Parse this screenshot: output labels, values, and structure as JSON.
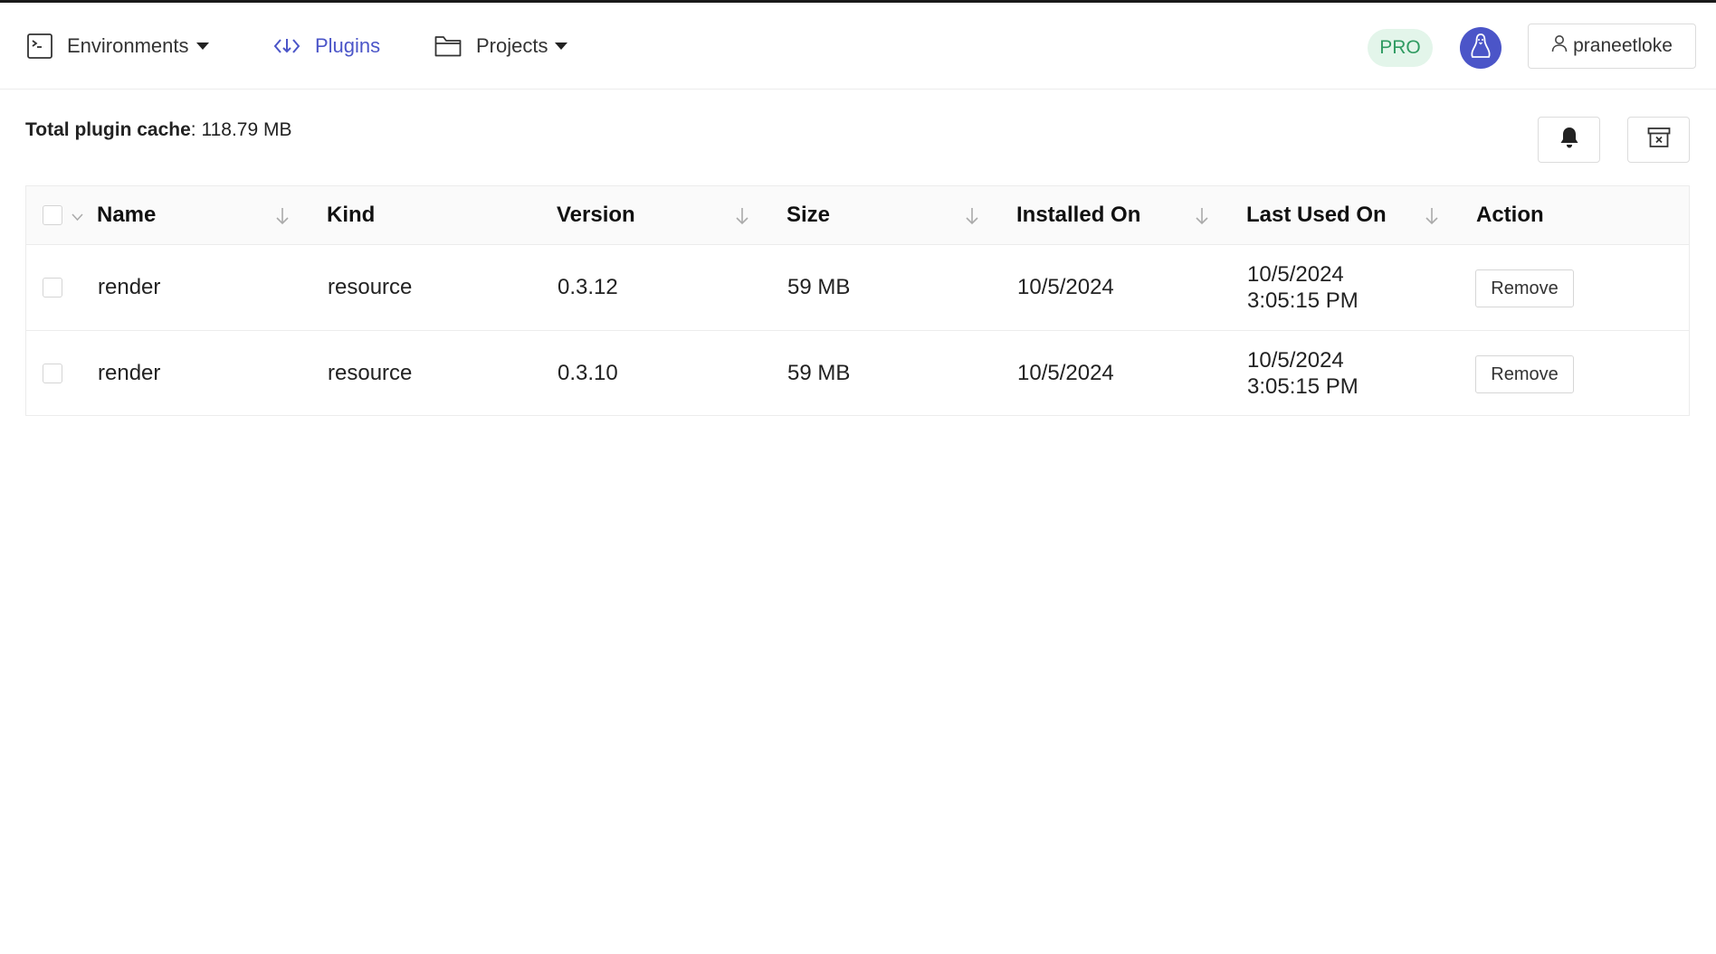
{
  "nav": {
    "environments_label": "Environments",
    "plugins_label": "Plugins",
    "projects_label": "Projects",
    "active": "plugins"
  },
  "account": {
    "plan_badge": "PRO",
    "username": "praneetloke"
  },
  "summary": {
    "label": "Total plugin cache",
    "separator": ": ",
    "value": "118.79 MB"
  },
  "table": {
    "columns": [
      "Name",
      "Kind",
      "Version",
      "Size",
      "Installed On",
      "Last Used On",
      "Action"
    ],
    "rows": [
      {
        "name": "render",
        "kind": "resource",
        "version": "0.3.12",
        "size": "59 MB",
        "installed_on": "10/5/2024",
        "last_used_date": "10/5/2024",
        "last_used_time": "3:05:15 PM",
        "action": "Remove"
      },
      {
        "name": "render",
        "kind": "resource",
        "version": "0.3.10",
        "size": "59 MB",
        "installed_on": "10/5/2024",
        "last_used_date": "10/5/2024",
        "last_used_time": "3:05:15 PM",
        "action": "Remove"
      }
    ]
  },
  "colors": {
    "accent": "#4b55c8",
    "pro_bg": "#e3f5ea",
    "pro_text": "#2f9b61",
    "border": "#ececec"
  },
  "icons": {
    "environments": "terminal-icon",
    "plugins": "plugin-arrows-icon",
    "projects": "folder-icon",
    "avatar": "linux-tux-icon",
    "user": "user-icon",
    "notifications": "bell-icon",
    "clear_cache": "archive-x-icon",
    "sort": "arrow-down-icon"
  }
}
